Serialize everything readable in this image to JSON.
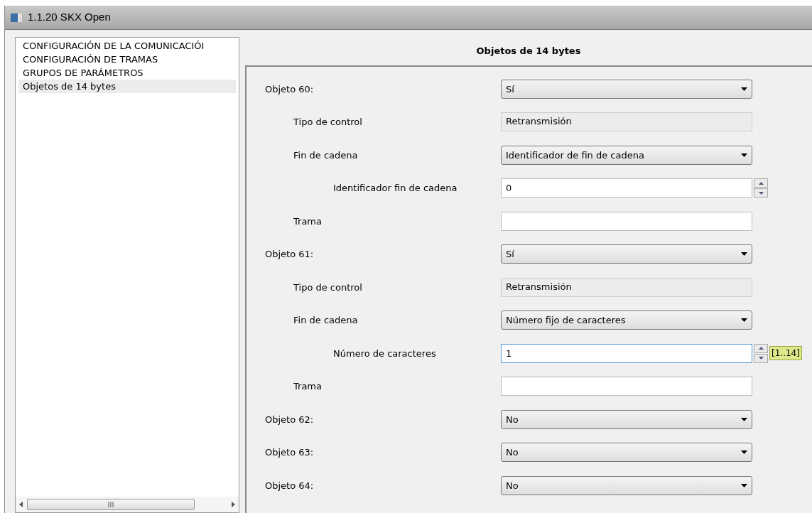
{
  "window": {
    "title": "1.1.20 SKX Open"
  },
  "sidebar": {
    "items": [
      {
        "label": "CONFIGURACIÓN DE LA COMUNICACIÓI",
        "selected": false
      },
      {
        "label": "CONFIGURACIÓN DE TRAMAS",
        "selected": false
      },
      {
        "label": "GRUPOS DE PARÁMETROS",
        "selected": false
      },
      {
        "label": "Objetos de 14 bytes",
        "selected": true
      }
    ]
  },
  "panel": {
    "title": "Objetos de 14 bytes",
    "rows": [
      {
        "label": "Objeto 60:",
        "kind": "select",
        "value": "Sí",
        "children": [
          {
            "label": "Tipo de control",
            "kind": "readonly",
            "value": "Retransmisión"
          },
          {
            "label": "Fin de cadena",
            "kind": "select",
            "value": "Identificador de fin de cadena",
            "children": [
              {
                "label": "Identificador fin de cadena",
                "kind": "spin",
                "value": "0",
                "focused": false
              }
            ]
          },
          {
            "label": "Trama",
            "kind": "text"
          }
        ]
      },
      {
        "label": "Objeto 61:",
        "kind": "select",
        "value": "Sí",
        "children": [
          {
            "label": "Tipo de control",
            "kind": "readonly",
            "value": "Retransmisión"
          },
          {
            "label": "Fin de cadena",
            "kind": "select",
            "value": "Número fijo de caracteres",
            "children": [
              {
                "label": "Número de caracteres",
                "kind": "spin",
                "value": "1",
                "focused": true,
                "range": "[1..14]"
              }
            ]
          },
          {
            "label": "Trama",
            "kind": "text"
          }
        ]
      },
      {
        "label": "Objeto 62:",
        "kind": "select",
        "value": "No"
      },
      {
        "label": "Objeto 63:",
        "kind": "select",
        "value": "No"
      },
      {
        "label": "Objeto 64:",
        "kind": "select",
        "value": "No"
      }
    ]
  }
}
